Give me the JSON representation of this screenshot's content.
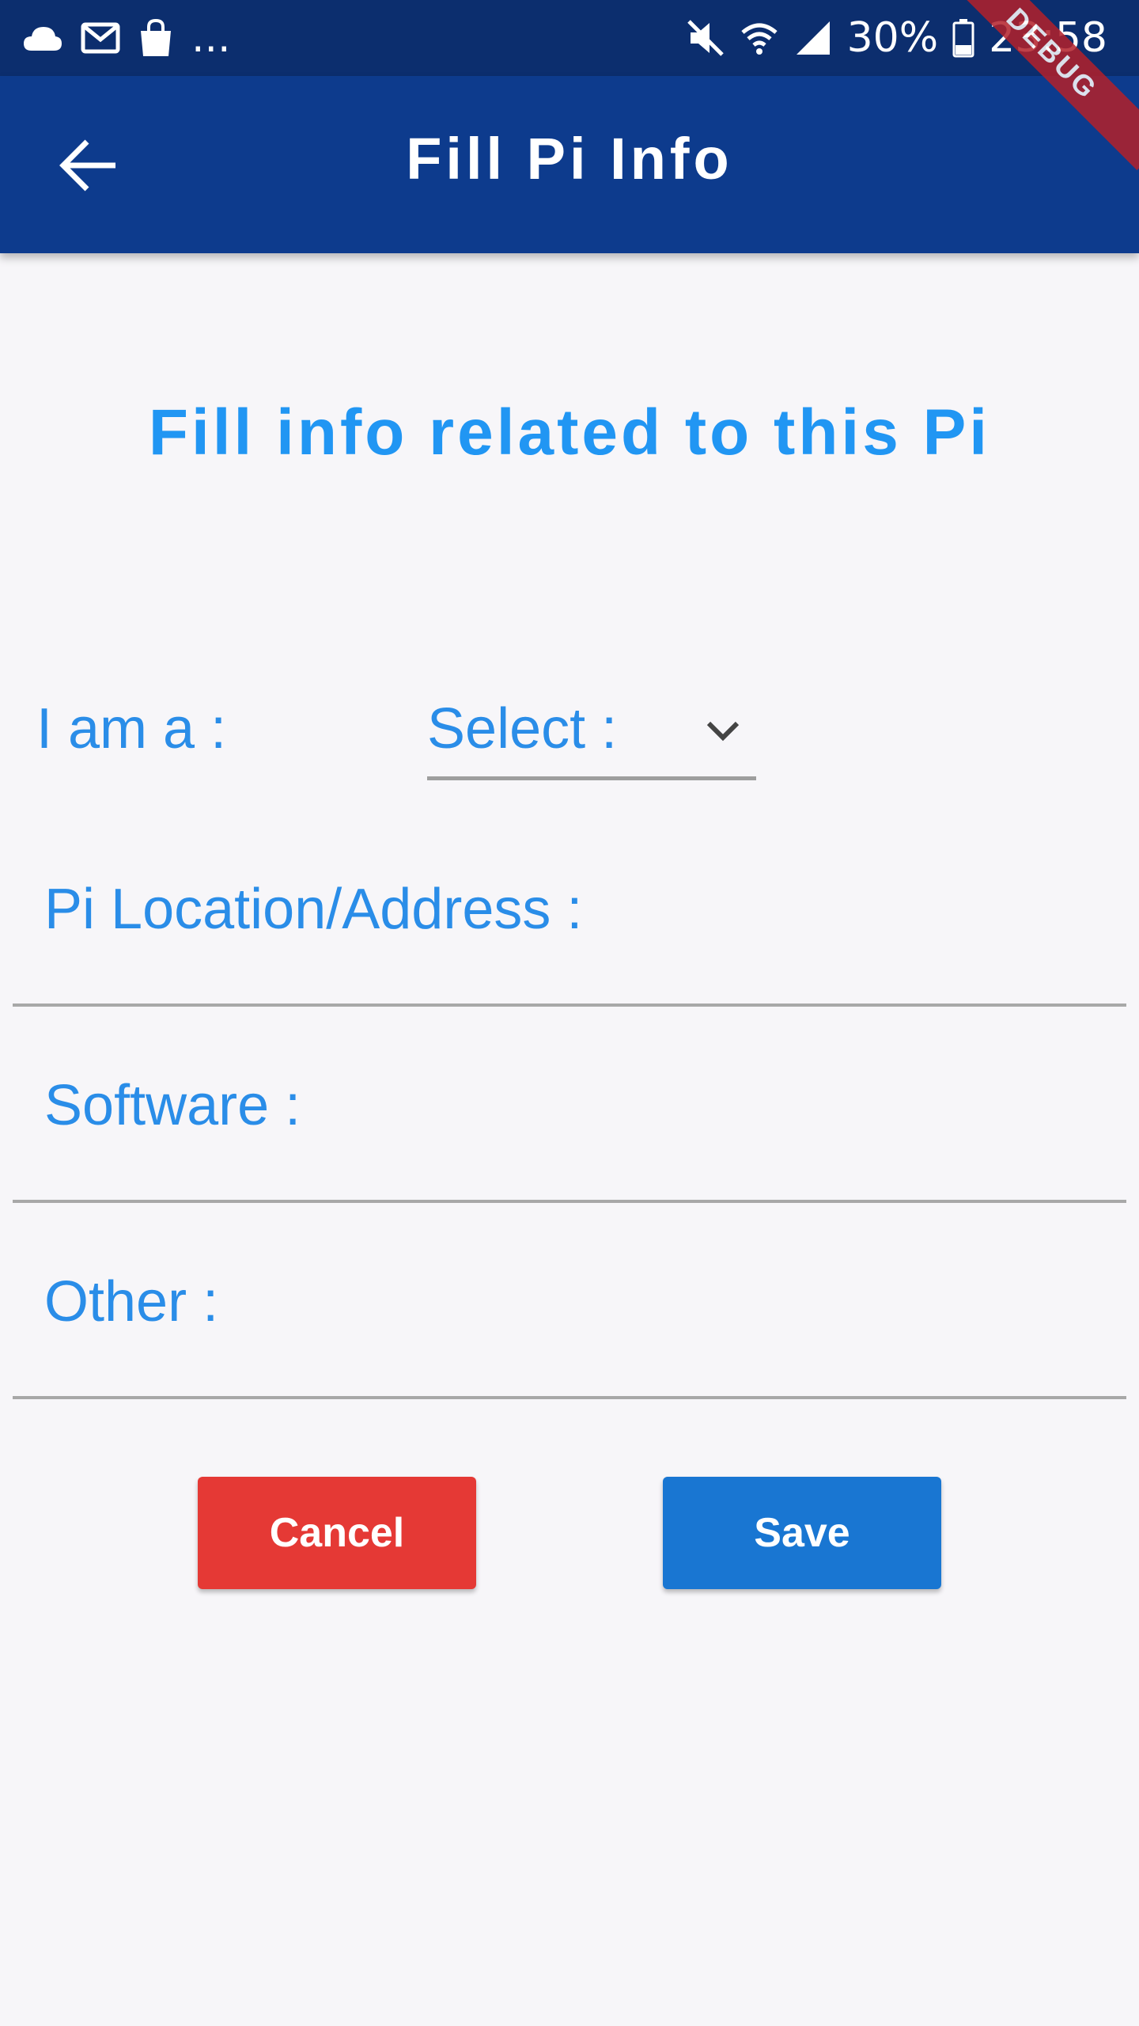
{
  "status_bar": {
    "left_icons": [
      "cloud-icon",
      "gmail-icon",
      "shopping-bag-icon"
    ],
    "more_notifications": "...",
    "right_icons": [
      "mute-icon",
      "wifi-icon",
      "signal-icon",
      "battery-icon"
    ],
    "battery_percent": "30%",
    "time": "23:58"
  },
  "app_bar": {
    "back_icon": "arrow-left-icon",
    "title": "Fill Pi Info",
    "debug_banner": "DEBUG"
  },
  "form": {
    "heading": "Fill info related to this Pi",
    "role_label": "I am a :",
    "role_dropdown": {
      "selected": "Select :",
      "icon": "chevron-down-icon"
    },
    "location_label": "Pi Location/Address :",
    "software_label": "Software :",
    "other_label": "Other :"
  },
  "actions": {
    "cancel_label": "Cancel",
    "save_label": "Save"
  },
  "colors": {
    "status_bar": "#0c2e6e",
    "app_bar": "#0d3b8d",
    "accent": "#2196f3",
    "cancel": "#e53935",
    "save": "#1976d2"
  }
}
